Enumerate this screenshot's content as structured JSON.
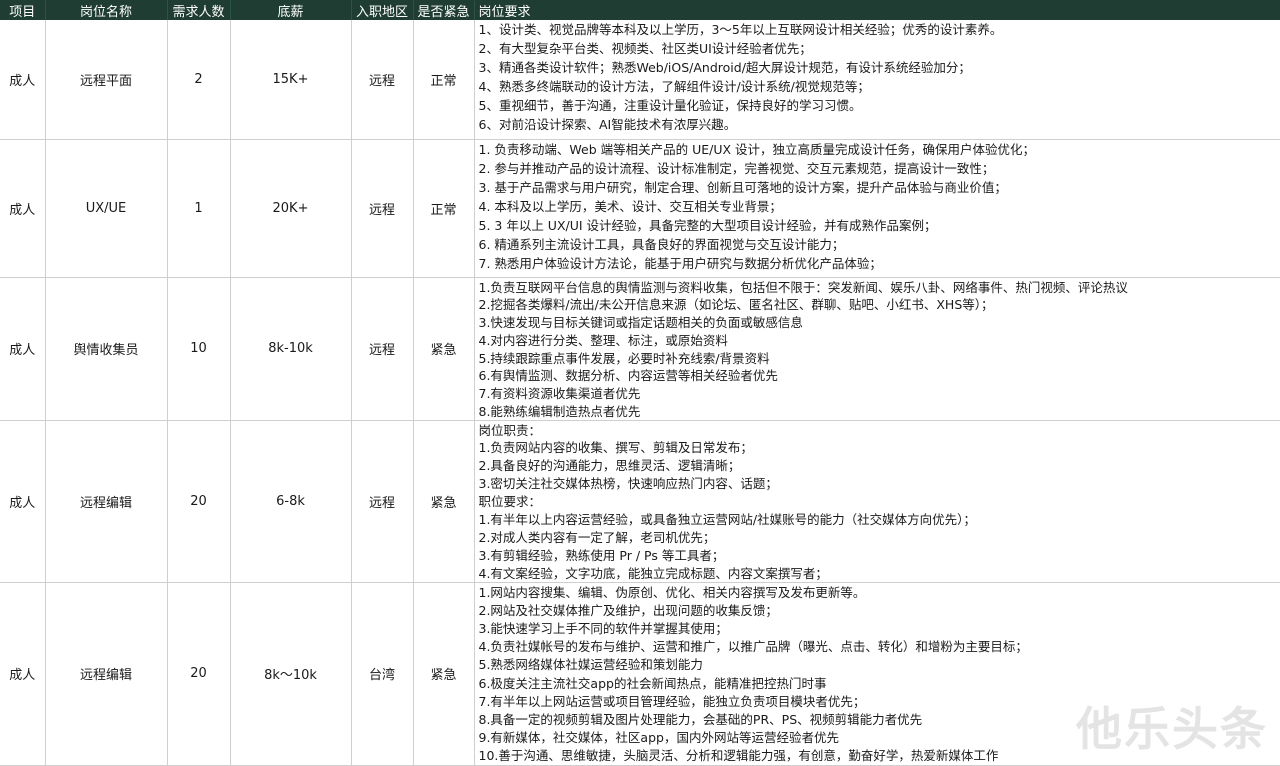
{
  "headers": [
    "项目",
    "岗位名称",
    "需求人数",
    "底薪",
    "入职地区",
    "是否紧急",
    "岗位要求"
  ],
  "rows": [
    {
      "project": "成人",
      "title": "远程平面",
      "count": "2",
      "salary": "15K+",
      "region": "远程",
      "urgency": "正常",
      "reqs": [
        "1、设计类、视觉品牌等本科及以上学历，3～5年以上互联网设计相关经验；优秀的设计素养。",
        "2、有大型复杂平台类、视频类、社区类UI设计经验者优先；",
        "3、精通各类设计软件；熟悉Web/iOS/Android/超大屏设计规范，有设计系统经验加分；",
        "4、熟悉多终端联动的设计方法，了解组件设计/设计系统/视觉规范等；",
        "5、重视细节，善于沟通，注重设计量化验证，保持良好的学习习惯。",
        "6、对前沿设计探索、AI智能技术有浓厚兴趣。"
      ]
    },
    {
      "project": "成人",
      "title": "UX/UE",
      "count": "1",
      "salary": "20K+",
      "region": "远程",
      "urgency": "正常",
      "reqs": [
        "1. 负责移动端、Web 端等相关产品的 UE/UX 设计，独立高质量完成设计任务，确保用户体验优化；",
        "2. 参与并推动产品的设计流程、设计标准制定，完善视觉、交互元素规范，提高设计一致性；",
        "3. 基于产品需求与用户研究，制定合理、创新且可落地的设计方案，提升产品体验与商业价值；",
        "4. 本科及以上学历，美术、设计、交互相关专业背景；",
        "5. 3 年以上 UX/UI 设计经验，具备完整的大型项目设计经验，并有成熟作品案例；",
        "6. 精通系列主流设计工具，具备良好的界面视觉与交互设计能力；",
        "7. 熟悉用户体验设计方法论，能基于用户研究与数据分析优化产品体验；"
      ]
    },
    {
      "project": "成人",
      "title": "舆情收集员",
      "count": "10",
      "salary": "8k-10k",
      "region": "远程",
      "urgency": "紧急",
      "reqs": [
        "1.负责互联网平台信息的舆情监测与资料收集，包括但不限于：突发新闻、娱乐八卦、网络事件、热门视频、评论热议",
        "2.挖掘各类爆料/流出/未公开信息来源（如论坛、匿名社区、群聊、贴吧、小红书、XHS等）；",
        "3.快速发现与目标关键词或指定话题相关的负面或敏感信息",
        "4.对内容进行分类、整理、标注，或原始资料",
        "5.持续跟踪重点事件发展，必要时补充线索/背景资料",
        "6.有舆情监测、数据分析、内容运营等相关经验者优先",
        "7.有资料资源收集渠道者优先",
        "8.能熟练编辑制造热点者优先"
      ]
    },
    {
      "project": "成人",
      "title": "远程编辑",
      "count": "20",
      "salary": "6-8k",
      "region": "远程",
      "urgency": "紧急",
      "reqs": [
        "岗位职责：",
        "1.负责网站内容的收集、撰写、剪辑及日常发布；",
        "2.具备良好的沟通能力，思维灵活、逻辑清晰；",
        "3.密切关注社交媒体热榜，快速响应热门内容、话题；",
        "职位要求：",
        "1.有半年以上内容运营经验，或具备独立运营网站/社媒账号的能力（社交媒体方向优先）；",
        "2.对成人类内容有一定了解，老司机优先；",
        "3.有剪辑经验，熟练使用 Pr / Ps 等工具者；",
        "4.有文案经验，文字功底，能独立完成标题、内容文案撰写者；"
      ]
    },
    {
      "project": "成人",
      "title": "远程编辑",
      "count": "20",
      "salary": "8k～10k",
      "region": "台湾",
      "urgency": "紧急",
      "reqs": [
        "1.网站内容搜集、编辑、伪原创、优化、相关内容撰写及发布更新等。",
        "2.网站及社交媒体推广及维护，出现问题的收集反馈；",
        "3.能快速学习上手不同的软件并掌握其使用；",
        "4.负责社媒帐号的发布与维护、运营和推广，以推广品牌（曝光、点击、转化）和增粉为主要目标；",
        "5.熟悉网络媒体社媒运营经验和策划能力",
        "6.极度关注主流社交app的社会新闻热点，能精准把控热门时事",
        "7.有半年以上网站运营或项目管理经验，能独立负责项目模块者优先；",
        "8.具备一定的视频剪辑及图片处理能力，会基础的PR、PS、视频剪辑能力者优先",
        "9.有新媒体，社交媒体，社区app，国内外网站等运营经验者优先",
        "10.善于沟通、思维敏捷，头脑灵活、分析和逻辑能力强，有创意，勤奋好学，热爱新媒体工作"
      ]
    }
  ],
  "watermark": "他乐头条"
}
